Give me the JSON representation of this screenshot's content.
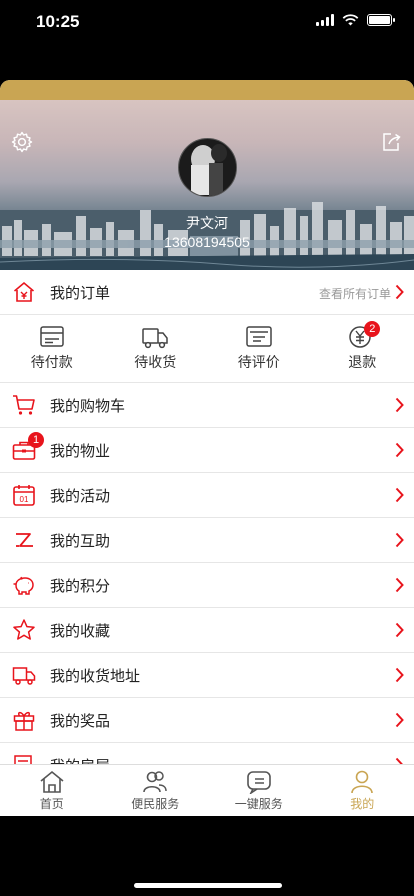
{
  "status": {
    "time": "10:25"
  },
  "profile": {
    "name": "尹文河",
    "phone": "13608194505"
  },
  "orders": {
    "label": "我的订单",
    "view_all": "查看所有订单"
  },
  "order_status": [
    {
      "label": "待付款",
      "icon": "wallet-icon"
    },
    {
      "label": "待收货",
      "icon": "truck-icon"
    },
    {
      "label": "待评价",
      "icon": "comment-icon"
    },
    {
      "label": "退款",
      "icon": "yuan-icon",
      "badge": "2"
    }
  ],
  "menu": [
    {
      "label": "我的购物车",
      "icon": "cart-icon"
    },
    {
      "label": "我的物业",
      "icon": "briefcase-icon",
      "badge": "1"
    },
    {
      "label": "我的活动",
      "icon": "calendar-icon",
      "icon_text": "01"
    },
    {
      "label": "我的互助",
      "icon": "exchange-icon"
    },
    {
      "label": "我的积分",
      "icon": "piggy-bank-icon"
    },
    {
      "label": "我的收藏",
      "icon": "star-icon"
    },
    {
      "label": "我的收货地址",
      "icon": "delivery-truck-icon"
    },
    {
      "label": "我的奖品",
      "icon": "gift-icon"
    },
    {
      "label": "我的房屋",
      "icon": "house-doc-icon"
    }
  ],
  "tabs": [
    {
      "label": "首页",
      "icon": "home-icon"
    },
    {
      "label": "便民服务",
      "icon": "people-icon"
    },
    {
      "label": "一键服务",
      "icon": "service-icon"
    },
    {
      "label": "我的",
      "icon": "user-icon",
      "active": true
    }
  ],
  "colors": {
    "accent": "#c9a553",
    "icon_red": "#e8141c",
    "text": "#222222",
    "muted": "#9a9a9a"
  }
}
